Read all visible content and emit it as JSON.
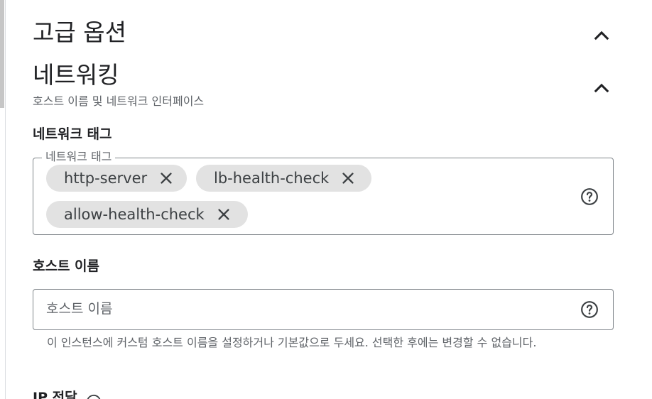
{
  "advanced": {
    "title": "고급 옵션",
    "toggle_icon": "chevron-up-icon"
  },
  "networking": {
    "title": "네트워킹",
    "description": "호스트 이름 및 네트워크 인터페이스",
    "toggle_icon": "chevron-up-icon"
  },
  "network_tags": {
    "label": "네트워크 태그",
    "legend": "네트워크 태그",
    "chips": [
      {
        "label": "http-server"
      },
      {
        "label": "lb-health-check"
      },
      {
        "label": "allow-health-check"
      }
    ],
    "help_icon": "help-circle-icon"
  },
  "hostname": {
    "label": "호스트 이름",
    "value": "",
    "placeholder": "호스트 이름",
    "help_icon": "help-circle-icon",
    "helper": "이 인스턴스에 커스텀 호스트 이름을 설정하거나 기본값으로 두세요. 선택한 후에는 변경할 수 없습니다."
  },
  "ip_forwarding": {
    "label": "IP 전달"
  },
  "colors": {
    "text": "#202124",
    "secondary": "#5f6368",
    "border": "#80868b",
    "chip": "#e2e2e2"
  }
}
